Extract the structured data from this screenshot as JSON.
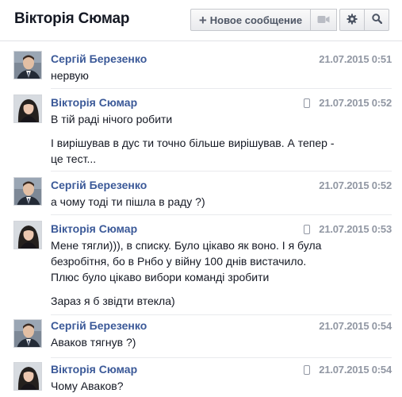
{
  "header": {
    "title": "Вікторія Сюмар",
    "new_message_label": "Новое сообщение"
  },
  "messages": [
    {
      "author": "Сергій Березенко",
      "time": "21.07.2015 0:51",
      "mobile": false,
      "avatar": "male",
      "lines": [
        "нервую"
      ]
    },
    {
      "author": "Вікторія Сюмар",
      "time": "21.07.2015 0:52",
      "mobile": true,
      "avatar": "female",
      "lines": [
        "В тій раді нічого робити",
        "І вирішував в дус ти точно більше вирішував. А тепер -",
        "це тест..."
      ]
    },
    {
      "author": "Сергій Березенко",
      "time": "21.07.2015 0:52",
      "mobile": false,
      "avatar": "male",
      "lines": [
        "а чому тоді ти пішла в раду ?)"
      ]
    },
    {
      "author": "Вікторія Сюмар",
      "time": "21.07.2015 0:53",
      "mobile": true,
      "avatar": "female",
      "lines": [
        "Мене тягли))), в списку. Було цікаво як воно. І я була",
        "безробітня, бо в Рнбо у війну 100 днів вистачило.",
        "Плюс було цікаво вибори команді зробити",
        "Зараз я б звідти втекла)"
      ]
    },
    {
      "author": "Сергій Березенко",
      "time": "21.07.2015 0:54",
      "mobile": false,
      "avatar": "male",
      "lines": [
        "Аваков тягнув ?)"
      ]
    },
    {
      "author": "Вікторія Сюмар",
      "time": "21.07.2015 0:54",
      "mobile": true,
      "avatar": "female",
      "lines": [
        "Чому Аваков?"
      ]
    }
  ]
}
